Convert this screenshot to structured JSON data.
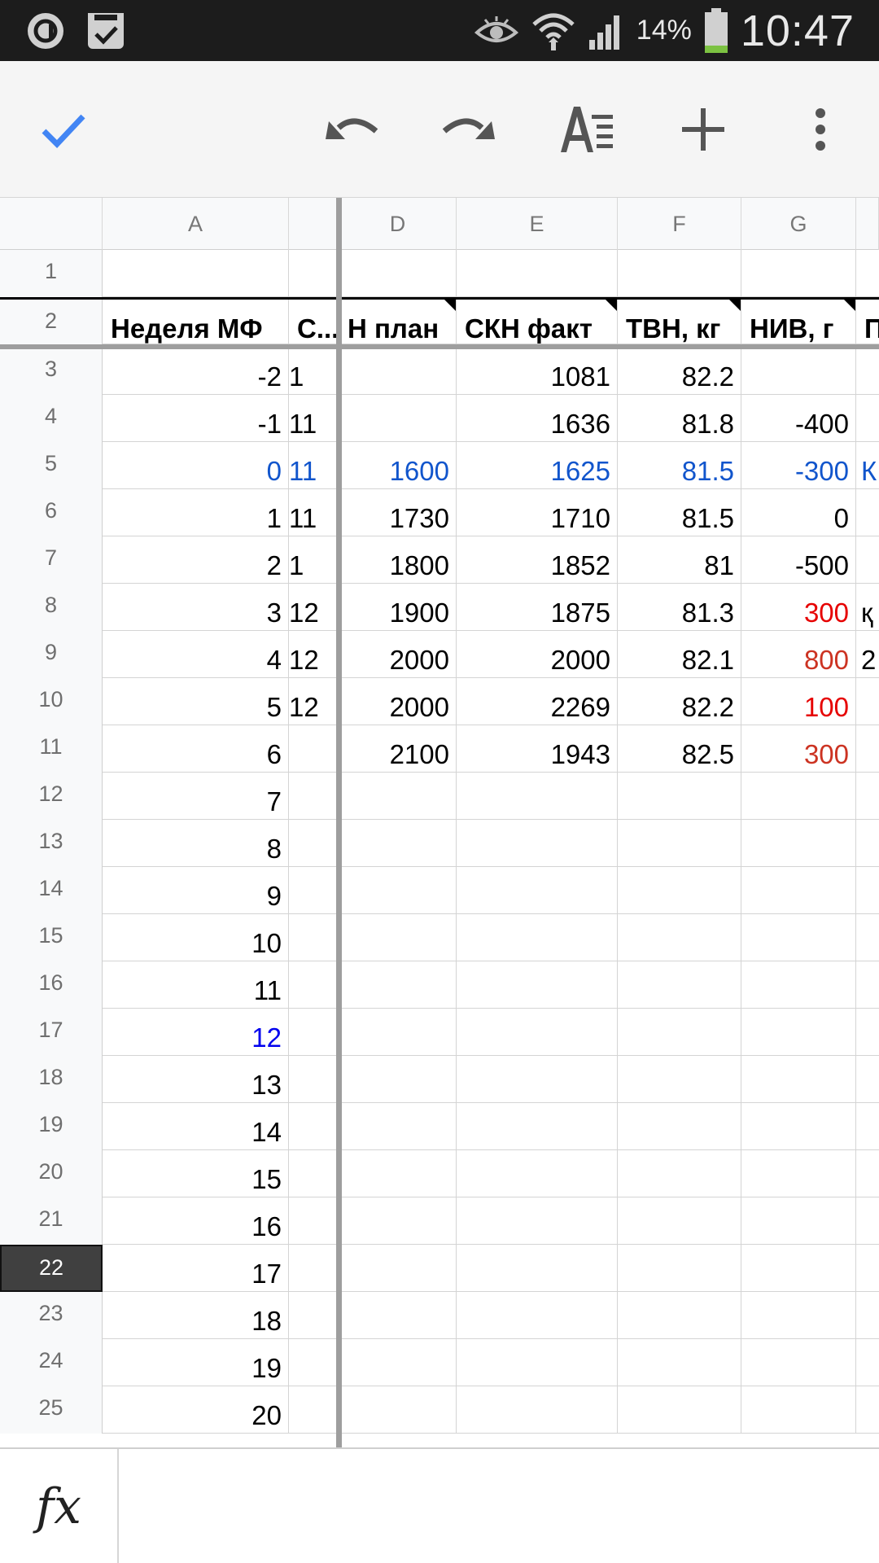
{
  "status_bar": {
    "battery_percent": "14%",
    "time": "10:47",
    "icons": [
      "app-notification-icon",
      "task-notification-icon",
      "eye-icon",
      "wifi-icon",
      "signal-icon",
      "battery-icon"
    ]
  },
  "toolbar": {
    "icons": [
      "check-icon",
      "undo-icon",
      "redo-icon",
      "text-format-icon",
      "plus-icon",
      "more-vert-icon"
    ],
    "accent_color": "#4285f4"
  },
  "sheet": {
    "column_headers": [
      "A",
      "D",
      "E",
      "F",
      "G"
    ],
    "header_row": {
      "number": "2",
      "a": "Неделя МФ",
      "b": "С...",
      "d": "Н план",
      "e": "СКН факт",
      "f": "ТВН, кг",
      "g": "НИВ, г",
      "h": "П"
    },
    "rows": [
      {
        "n": "1",
        "a": "",
        "b": "",
        "d": "",
        "e": "",
        "f": "",
        "g": "",
        "h": ""
      },
      {
        "n": "3",
        "a": "-2",
        "b": "1",
        "d": "",
        "e": "1081",
        "f": "82.2",
        "g": "",
        "h": ""
      },
      {
        "n": "4",
        "a": "-1",
        "b": "11",
        "d": "",
        "e": "1636",
        "f": "81.8",
        "g": "-400",
        "h": ""
      },
      {
        "n": "5",
        "a": "0",
        "b": "11",
        "d": "1600",
        "e": "1625",
        "f": "81.5",
        "g": "-300",
        "h": "К"
      },
      {
        "n": "6",
        "a": "1",
        "b": "11",
        "d": "1730",
        "e": "1710",
        "f": "81.5",
        "g": "0",
        "h": ""
      },
      {
        "n": "7",
        "a": "2",
        "b": "1",
        "d": "1800",
        "e": "1852",
        "f": "81",
        "g": "-500",
        "h": ""
      },
      {
        "n": "8",
        "a": "3",
        "b": "12",
        "d": "1900",
        "e": "1875",
        "f": "81.3",
        "g": "300",
        "h": "қ"
      },
      {
        "n": "9",
        "a": "4",
        "b": "12",
        "d": "2000",
        "e": "2000",
        "f": "82.1",
        "g": "800",
        "h": "2"
      },
      {
        "n": "10",
        "a": "5",
        "b": "12",
        "d": "2000",
        "e": "2269",
        "f": "82.2",
        "g": "100",
        "h": ""
      },
      {
        "n": "11",
        "a": "6",
        "b": "",
        "d": "2100",
        "e": "1943",
        "f": "82.5",
        "g": "300",
        "h": ""
      },
      {
        "n": "12",
        "a": "7"
      },
      {
        "n": "13",
        "a": "8"
      },
      {
        "n": "14",
        "a": "9"
      },
      {
        "n": "15",
        "a": "10"
      },
      {
        "n": "16",
        "a": "11"
      },
      {
        "n": "17",
        "a": "12"
      },
      {
        "n": "18",
        "a": "13"
      },
      {
        "n": "19",
        "a": "14"
      },
      {
        "n": "20",
        "a": "15"
      },
      {
        "n": "21",
        "a": "16"
      },
      {
        "n": "22",
        "a": "17"
      },
      {
        "n": "23",
        "a": "18"
      },
      {
        "n": "24",
        "a": "19"
      },
      {
        "n": "25",
        "a": "20"
      }
    ],
    "selected_row": "22",
    "colors": {
      "blue": "#1155cc",
      "bright_blue": "#0000ee",
      "red": "#e60000",
      "dark_red": "#cc3322"
    }
  },
  "formula_bar": {
    "label": "fx",
    "value": ""
  }
}
